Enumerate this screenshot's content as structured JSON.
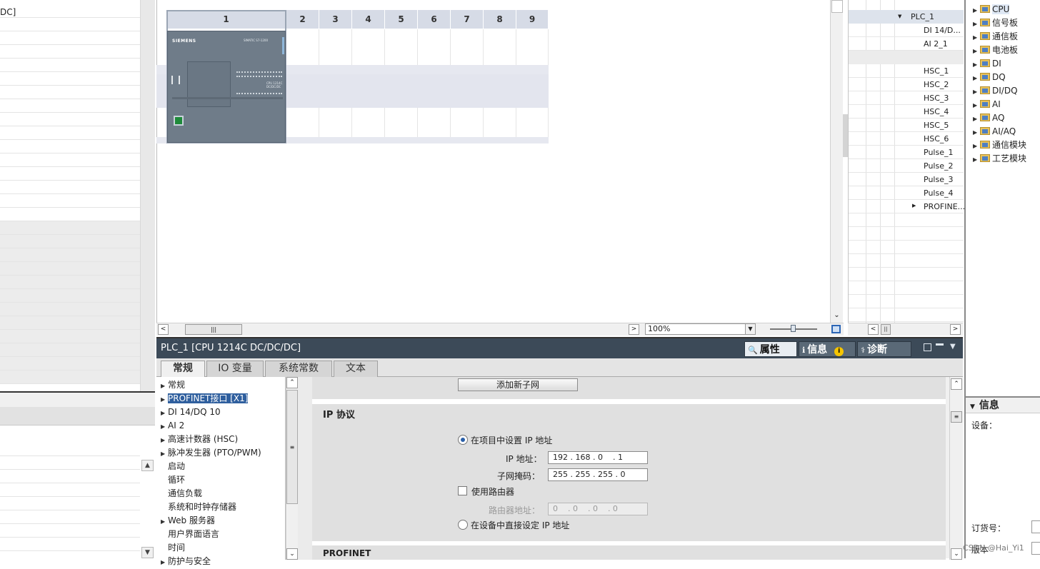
{
  "left_pane": {
    "top_text": "DC]"
  },
  "device_view": {
    "slots": [
      "1",
      "2",
      "3",
      "4",
      "5",
      "6",
      "7",
      "8",
      "9"
    ],
    "cpu_brand": "SIEMENS",
    "cpu_model_text": "SIMATIC S7-1200",
    "cpu_label": "CPU 1214C DC/DC/DC",
    "zoom": "100%",
    "zoom_unit_icon": "zoom-fit-icon"
  },
  "overview": {
    "items": [
      {
        "label": "PLC_1",
        "expanded": true
      },
      {
        "label": "DI 14/D..."
      },
      {
        "label": "AI 2_1"
      },
      {
        "label": ""
      },
      {
        "label": "HSC_1"
      },
      {
        "label": "HSC_2"
      },
      {
        "label": "HSC_3"
      },
      {
        "label": "HSC_4"
      },
      {
        "label": "HSC_5"
      },
      {
        "label": "HSC_6"
      },
      {
        "label": "Pulse_1"
      },
      {
        "label": "Pulse_2"
      },
      {
        "label": "Pulse_3"
      },
      {
        "label": "Pulse_4"
      },
      {
        "label": "PROFINE...",
        "collapsed": true
      }
    ]
  },
  "catalog": {
    "items": [
      "CPU",
      "信号板",
      "通信板",
      "电池板",
      "DI",
      "DQ",
      "DI/DQ",
      "AI",
      "AQ",
      "AI/AQ",
      "通信模块",
      "工艺模块"
    ]
  },
  "info_panel": {
    "title": "信息",
    "device_label": "设备：",
    "order_label": "订货号：",
    "version_label": "版本",
    "watermark": "CSDN @Hai_Yi1"
  },
  "inspector": {
    "title": "PLC_1 [CPU 1214C DC/DC/DC]",
    "tabs": {
      "properties": "属性",
      "info": "信息",
      "diagnostics": "诊断"
    },
    "subtabs": [
      "常规",
      "IO 变量",
      "系统常数",
      "文本"
    ],
    "nav": [
      {
        "label": "常规",
        "arrow": true
      },
      {
        "label": "PROFINET接口 [X1]",
        "arrow": true,
        "selected": true
      },
      {
        "label": "DI 14/DQ 10",
        "arrow": true
      },
      {
        "label": "AI 2",
        "arrow": true
      },
      {
        "label": "高速计数器 (HSC)",
        "arrow": true
      },
      {
        "label": "脉冲发生器 (PTO/PWM)",
        "arrow": true
      },
      {
        "label": "启动"
      },
      {
        "label": "循环"
      },
      {
        "label": "通信负载"
      },
      {
        "label": "系统和时钟存储器"
      },
      {
        "label": "Web 服务器",
        "arrow": true
      },
      {
        "label": "用户界面语言"
      },
      {
        "label": "时间"
      },
      {
        "label": "防护与安全"
      }
    ],
    "add_subnet_button": "添加新子网",
    "ip_section_title": "IP 协议",
    "radio_project_ip": "在项目中设置 IP 地址",
    "ip_label": "IP 地址：",
    "ip_value": "192 . 168 . 0    . 1",
    "subnet_label": "子网掩码：",
    "subnet_value": "255 . 255 . 255 . 0",
    "use_router_label": "使用路由器",
    "router_label": "路由器地址：",
    "router_value": "0    . 0    . 0    . 0",
    "radio_device_ip": "在设备中直接设定 IP 地址",
    "profinet_section_title": "PROFINET"
  }
}
